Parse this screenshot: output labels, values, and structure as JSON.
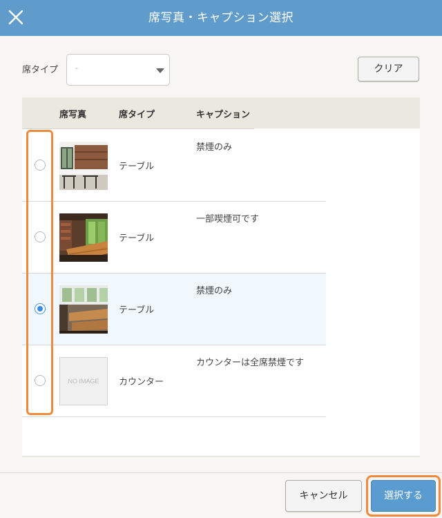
{
  "header": {
    "title": "席写真・キャプション選択"
  },
  "filter": {
    "label": "席タイプ",
    "select_value": "-"
  },
  "buttons": {
    "clear": "クリア",
    "cancel": "キャンセル",
    "select": "選択する"
  },
  "table": {
    "headers": {
      "photo": "席写真",
      "type": "席タイプ",
      "caption": "キャプション"
    },
    "rows": [
      {
        "type": "テーブル",
        "caption": "禁煙のみ",
        "selected": false,
        "photo": "restaurant-photo-1"
      },
      {
        "type": "テーブル",
        "caption": "一部喫煙可です",
        "selected": false,
        "photo": "restaurant-photo-2"
      },
      {
        "type": "テーブル",
        "caption": "禁煙のみ",
        "selected": true,
        "photo": "restaurant-photo-3"
      },
      {
        "type": "カウンター",
        "caption": "カウンターは全席禁煙です",
        "selected": false,
        "photo": "no-image",
        "no_image_label": "NO IMAGE"
      }
    ]
  },
  "colors": {
    "header": "#5f9ccb",
    "accent": "#3b8be0",
    "highlight": "#ef8a3c"
  }
}
